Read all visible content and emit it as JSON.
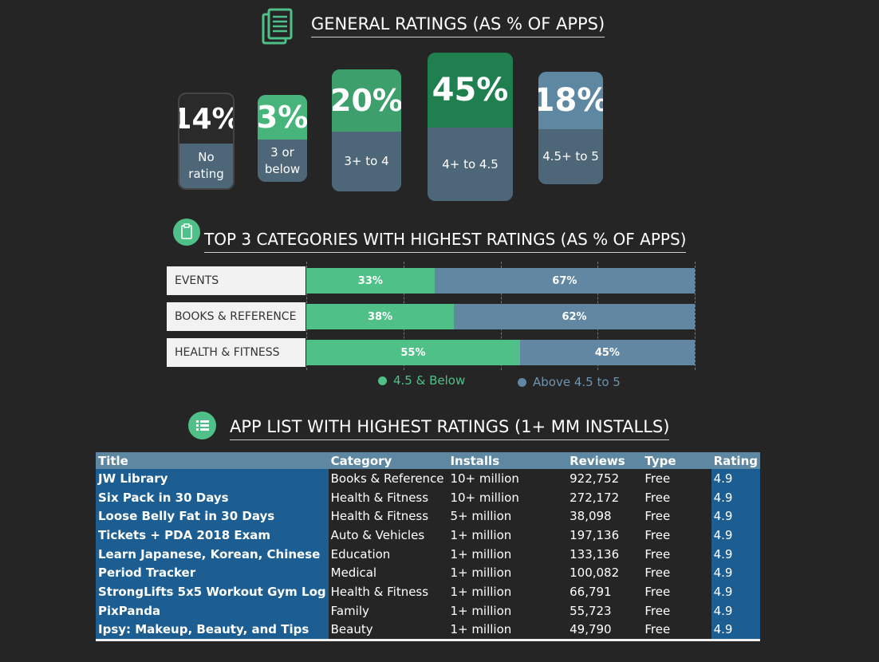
{
  "general": {
    "title": "GENERAL RATINGS (AS % OF APPS)",
    "tiles": [
      {
        "value": 14,
        "label": "No rating",
        "pct_text": "14%",
        "color": "#2a2a2a"
      },
      {
        "value": 3,
        "label": "3 or below",
        "pct_text": "3%",
        "color": "#47b47c"
      },
      {
        "value": 20,
        "label": "3+ to 4",
        "pct_text": "20%",
        "color": "#3d9f6b"
      },
      {
        "value": 45,
        "label": "4+ to 4.5",
        "pct_text": "45%",
        "color": "#1f7f4e"
      },
      {
        "value": 18,
        "label": "4.5+ to 5",
        "pct_text": "18%",
        "color": "#5e87a2"
      }
    ]
  },
  "categories": {
    "title": "TOP 3 CATEGORIES WITH HIGHEST RATINGS (AS % OF APPS)",
    "legend": [
      {
        "label": "4.5 & Below",
        "color": "#4fc088"
      },
      {
        "label": "Above 4.5 to 5",
        "color": "#6187a2"
      }
    ]
  },
  "chart_data": {
    "type": "bar",
    "orientation": "horizontal",
    "stacked": true,
    "categories": [
      "EVENTS",
      "BOOKS & REFERENCE",
      "HEALTH & FITNESS"
    ],
    "series": [
      {
        "name": "4.5 & Below",
        "values": [
          33,
          38,
          55
        ],
        "labels": [
          "33%",
          "38%",
          "55%"
        ],
        "color": "#4fc088"
      },
      {
        "name": "Above 4.5 to 5",
        "values": [
          67,
          62,
          45
        ],
        "labels": [
          "67%",
          "62%",
          "45%"
        ],
        "color": "#6187a2"
      }
    ],
    "xlim": [
      0,
      100
    ],
    "legend_position": "bottom"
  },
  "apps": {
    "title": "APP LIST WITH HIGHEST RATINGS (1+ MM INSTALLS)",
    "columns": [
      "Title",
      "Category",
      "Installs",
      "Reviews",
      "Type",
      "Rating"
    ],
    "rows": [
      [
        "JW Library",
        "Books & Reference",
        "10+ million",
        "922,752",
        "Free",
        "4.9"
      ],
      [
        "Six Pack in 30 Days",
        "Health & Fitness",
        "10+ million",
        "272,172",
        "Free",
        "4.9"
      ],
      [
        "Loose Belly Fat in 30 Days",
        "Health & Fitness",
        "5+ million",
        "38,098",
        "Free",
        "4.9"
      ],
      [
        "Tickets + PDA 2018 Exam",
        "Auto & Vehicles",
        "1+ million",
        "197,136",
        "Free",
        "4.9"
      ],
      [
        "Learn Japanese, Korean, Chinese",
        "Education",
        "1+ million",
        "133,136",
        "Free",
        "4.9"
      ],
      [
        "Period Tracker",
        "Medical",
        "1+ million",
        "100,082",
        "Free",
        "4.9"
      ],
      [
        "StrongLifts 5x5 Workout Gym Log",
        "Health & Fitness",
        "1+ million",
        "66,791",
        "Free",
        "4.9"
      ],
      [
        "PixPanda",
        "Family",
        "1+ million",
        "55,723",
        "Free",
        "4.9"
      ],
      [
        "Ipsy: Makeup, Beauty, and Tips",
        "Beauty",
        "1+ million",
        "49,790",
        "Free",
        "4.9"
      ]
    ]
  },
  "icons": {
    "general": "document-icon",
    "categories": "clipboard-icon",
    "apps": "list-icon"
  }
}
